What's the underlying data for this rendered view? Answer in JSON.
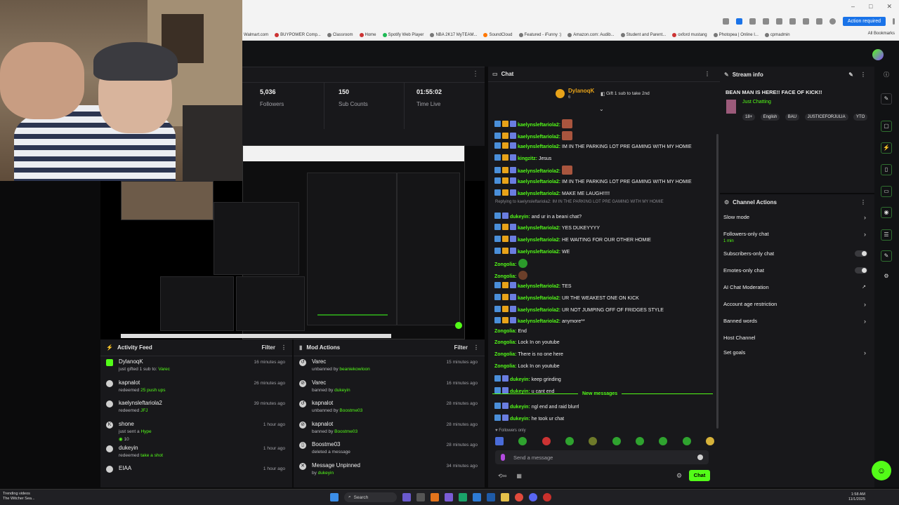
{
  "browser": {
    "action_required": "Action required",
    "window_controls": [
      "–",
      "□",
      "✕"
    ],
    "bookmarks": [
      "Walmart.com",
      "BUYPOWER Comp...",
      "Classroom",
      "Home",
      "Spotify Web Player",
      "NBA 2K17 MyTEAM...",
      "SoundCloud",
      "Featured - iFunny :)",
      "Amazon.com: Audib...",
      "Student and Parent...",
      "oxford mustang",
      "Photopea | Online I...",
      "cpmadmin"
    ],
    "all_bookmarks": "All Bookmarks"
  },
  "stats": {
    "followers_value": "5,036",
    "followers_label": "Followers",
    "subs_value": "150",
    "subs_label": "Sub Counts",
    "time_value": "01:55:02",
    "time_label": "Time Live"
  },
  "activity_feed": {
    "title": "Activity Feed",
    "filter": "Filter",
    "items": [
      {
        "name": "DylanoqK",
        "desc_prefix": "just gifted 1 sub to: ",
        "desc_highlight": "Varec",
        "time": "16 minutes ago"
      },
      {
        "name": "kapnalot",
        "desc_prefix": "redeemed ",
        "desc_highlight": "25 push ups",
        "time": "26 minutes ago"
      },
      {
        "name": "kaelynsleftariola2",
        "desc_prefix": "redeemed ",
        "desc_highlight": "JFJ",
        "time": "39 minutes ago"
      },
      {
        "name": "shone",
        "desc_prefix": "just sent a ",
        "desc_highlight": "Hype",
        "extra": "10",
        "time": "1 hour ago"
      },
      {
        "name": "dukeyin",
        "desc_prefix": "redeemed ",
        "desc_highlight": "take a shot",
        "time": "1 hour ago"
      },
      {
        "name": "EIAA",
        "desc_prefix": "",
        "desc_highlight": "",
        "time": "1 hour ago"
      }
    ]
  },
  "mod_actions": {
    "title": "Mod Actions",
    "filter": "Filter",
    "items": [
      {
        "name": "Varec",
        "desc_prefix": "unbanned by ",
        "desc_highlight": "beaniekowloon",
        "time": "15 minutes ago"
      },
      {
        "name": "Varec",
        "desc_prefix": "banned by ",
        "desc_highlight": "dukeyin",
        "time": "16 minutes ago"
      },
      {
        "name": "kapnalot",
        "desc_prefix": "unbanned by ",
        "desc_highlight": "Boostme03",
        "time": "28 minutes ago"
      },
      {
        "name": "kapnalot",
        "desc_prefix": "banned by ",
        "desc_highlight": "Boostme03",
        "time": "28 minutes ago"
      },
      {
        "name": "Boostme03",
        "desc_prefix": "deleted a message",
        "desc_highlight": "",
        "time": "28 minutes ago"
      },
      {
        "name": "Message Unpinned",
        "desc_prefix": "by ",
        "desc_highlight": "dukeyin",
        "time": "34 minutes ago"
      }
    ]
  },
  "chat": {
    "title": "Chat",
    "pinned_user": "DylanoqK",
    "pinned_count": "6",
    "pinned_text": "Gift 1 sub to take 2nd",
    "reply_context": "Replying to kaelynsleftariola2: IM IN THE PARKING LOT PRE GAMING WITH MY HOMIE",
    "messages": [
      {
        "user": "kaelynsleftariola2:",
        "text": "",
        "emote": "brown"
      },
      {
        "user": "kaelynsleftariola2:",
        "text": "",
        "emote": "brown"
      },
      {
        "user": "kaelynsleftariola2:",
        "text": "IM IN THE PARKING LOT PRE GAMING WITH MY HOMIE"
      },
      {
        "user": "kingzitz:",
        "text": "Jesus"
      },
      {
        "user": "kaelynsleftariola2:",
        "text": "",
        "emote": "brown"
      },
      {
        "user": "kaelynsleftariola2:",
        "text": "IM IN THE PARKING LOT PRE GAMING WITH MY HOMIE"
      },
      {
        "user": "kaelynsleftariola2:",
        "text": "MAKE ME LAUGH!!!!!"
      },
      {
        "user": "dukeyin:",
        "text": "and ur in a beani chat?"
      },
      {
        "user": "kaelynsleftariola2:",
        "text": "YES DUKEYYYY"
      },
      {
        "user": "kaelynsleftariola2:",
        "text": "HE WAITING FOR OUR OTHER HOMIE"
      },
      {
        "user": "kaelynsleftariola2:",
        "text": "WE"
      },
      {
        "user": "Zongolia:",
        "text": "",
        "emote": "green"
      },
      {
        "user": "Zongolia:",
        "text": "",
        "emote": "dark"
      },
      {
        "user": "kaelynsleftariola2:",
        "text": "TES"
      },
      {
        "user": "kaelynsleftariola2:",
        "text": "UR THE WEAKEST ONE ON KICK"
      },
      {
        "user": "kaelynsleftariola2:",
        "text": "UR NOT JUMPING OFF OF FRIDGES STYLE"
      },
      {
        "user": "kaelynsleftariola2:",
        "text": "anymore**"
      },
      {
        "user": "Zongolia:",
        "text": "End"
      },
      {
        "user": "Zongolia:",
        "text": "Lock In on youtube"
      },
      {
        "user": "Zongolia:",
        "text": "There is no one here"
      },
      {
        "user": "Zongolia:",
        "text": "Lock In on youtube"
      },
      {
        "user": "dukeyin:",
        "text": "keep grinding"
      },
      {
        "user": "dukeyin:",
        "text": "u cant end"
      },
      {
        "user": "dukeyin:",
        "text": "ngl end and raid blurrl"
      },
      {
        "user": "dukeyin:",
        "text": "he took ur chat"
      }
    ],
    "new_messages": "New messages",
    "followers_only": "Followers only",
    "input_placeholder": "Send a message",
    "send_button": "Chat"
  },
  "stream_info": {
    "title": "Stream info",
    "stream_title": "BEAN MAN IS HERE!! FACE OF KICK!!",
    "category": "Just Chatting",
    "tags": [
      "18+",
      "English",
      "BAU",
      "JUSTICEFORJULIA",
      "YTO"
    ]
  },
  "channel_actions": {
    "title": "Channel Actions",
    "items": [
      {
        "label": "Slow mode",
        "control": "arrow"
      },
      {
        "label": "Followers-only chat",
        "sub": "1 min",
        "control": "arrow"
      },
      {
        "label": "Subscribers-only chat",
        "control": "toggle"
      },
      {
        "label": "Emotes-only chat",
        "control": "toggle"
      },
      {
        "label": "AI Chat Moderation",
        "control": "external"
      },
      {
        "label": "Account age restriction",
        "control": "arrow"
      },
      {
        "label": "Banned words",
        "control": "arrow"
      },
      {
        "label": "Host Channel",
        "control": "none"
      },
      {
        "label": "Set goals",
        "control": "arrow"
      }
    ]
  },
  "taskbar": {
    "weather_line1": "Trending videos",
    "weather_line2": "The Witcher Sea...",
    "search": "Search",
    "time": "1:58 AM",
    "date": "11/1/2025"
  },
  "colors": {
    "kick_green": "#53fc18",
    "panel_bg": "#18181b",
    "crown_gold": "#e8a319"
  }
}
